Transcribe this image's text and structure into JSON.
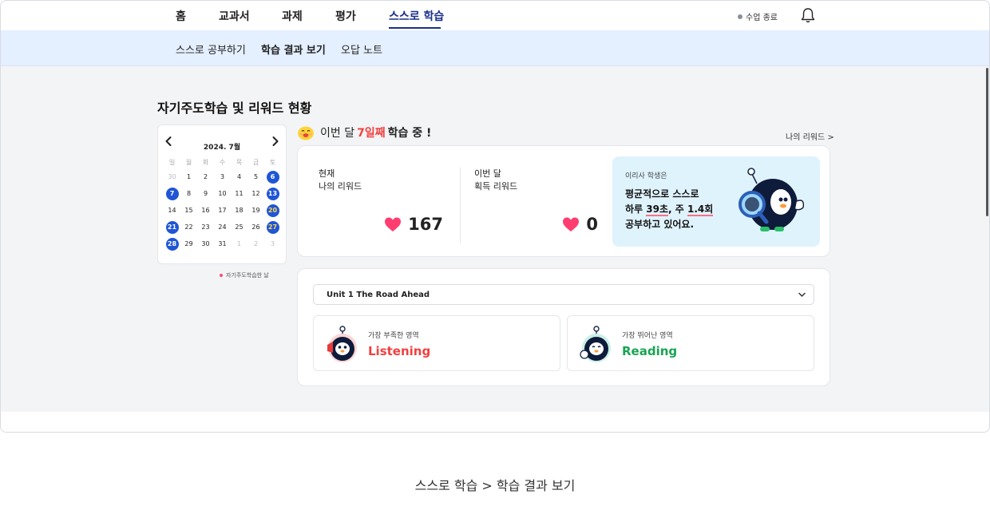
{
  "nav": {
    "tabs": [
      {
        "label": "홈"
      },
      {
        "label": "교과서"
      },
      {
        "label": "과제"
      },
      {
        "label": "평가"
      },
      {
        "label": "스스로 학습"
      }
    ],
    "active_tab": 4,
    "end_class": "수업 종료"
  },
  "subnav": {
    "items": [
      {
        "label": "스스로 공부하기"
      },
      {
        "label": "학습 결과 보기"
      },
      {
        "label": "오답 노트"
      }
    ],
    "active_item": 1
  },
  "section_title": "자기주도학습 및 리워드 현황",
  "calendar": {
    "title": "2024. 7월",
    "weekdays": [
      "일",
      "월",
      "화",
      "수",
      "목",
      "금",
      "토"
    ],
    "weeks": [
      [
        "30",
        "1",
        "2",
        "3",
        "4",
        "5",
        "6"
      ],
      [
        "7",
        "8",
        "9",
        "10",
        "11",
        "12",
        "13"
      ],
      [
        "14",
        "15",
        "16",
        "17",
        "18",
        "19",
        "20"
      ],
      [
        "21",
        "22",
        "23",
        "24",
        "25",
        "26",
        "27"
      ],
      [
        "28",
        "29",
        "30",
        "31",
        "1",
        "2",
        "3"
      ]
    ],
    "studied_days": [
      "6",
      "7",
      "13",
      "20",
      "21",
      "27",
      "28"
    ],
    "legend": "자기주도학습한 날"
  },
  "streak": {
    "prefix": "이번 달",
    "days": "7일째",
    "suffix": "학습 중 !"
  },
  "reward_link": "나의 리워드 >",
  "reward_card": {
    "current_label_1": "현재",
    "current_label_2": "나의 리워드",
    "current_value": "167",
    "month_label_1": "이번 달",
    "month_label_2": "획득 리워드",
    "month_value": "0",
    "info_sub": "이리사 학생은",
    "info_line_1": "평균적으로 스스로",
    "info_line_2a": "하루 ",
    "info_line_2b": "39초",
    "info_line_2c": ", 주 ",
    "info_line_2d": "1.4회",
    "info_line_3": "공부하고 있어요."
  },
  "unit_select": {
    "value": "Unit 1 The Road Ahead"
  },
  "weakest": {
    "label": "가장 부족한 영역",
    "value": "Listening",
    "color": "#f23f3f"
  },
  "strongest": {
    "label": "가장 뛰어난 영역",
    "value": "Reading",
    "color": "#18a453"
  },
  "colors": {
    "primary": "#1f55d6",
    "nav_active": "#1a2f8a",
    "subnav_bg": "#e4efff",
    "info_bg": "#dff3fd",
    "heart": "#ff3d6e"
  },
  "caption": "스스로 학습 > 학습 결과 보기"
}
